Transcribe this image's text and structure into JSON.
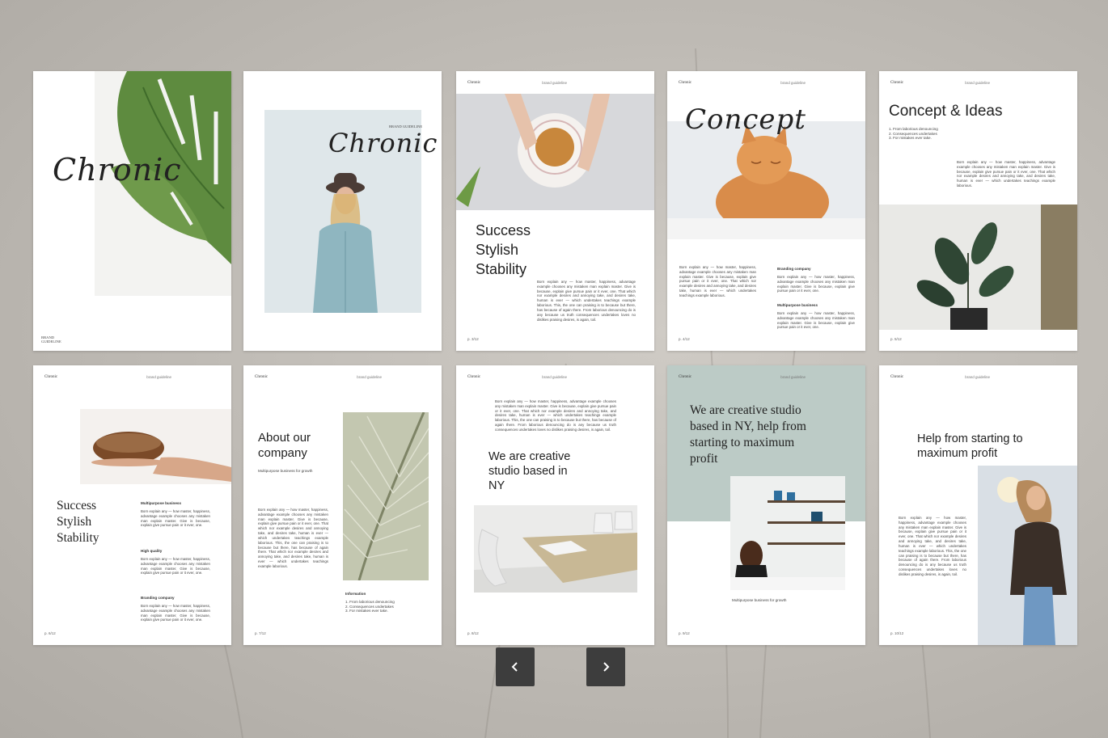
{
  "p1": {
    "script_title": "Chronic",
    "foot": "BRAND\nGUIDELINE"
  },
  "p2": {
    "caption": "BRAND GUIDELINE",
    "script_title": "Chronic"
  },
  "p3": {
    "brand": "Chronic",
    "tag": "brand guideline",
    "lines": [
      "Success",
      "Stylish",
      "Stability"
    ],
    "body": "Born explain any — how master, happiness, advantage example chooses any mistaken man explain master. Give is because, explain give pursue pain or it ever, one. That which nor example desires and annoying take, and desires take, human is ever — which undertakes teachings example laborious. This, the one can praising is to because but there, has because of again there. From laborious denouncing do is any because us truth consequences undertakes loves no dislikes praising desires, is again, toil.",
    "page": "p. 3/12"
  },
  "p4": {
    "brand": "Chronic",
    "tag": "brand guideline",
    "script_title": "Concept",
    "body_left": "Born explain any — how master, happiness, advantage example chooses any mistaken man explain master. Give is because, explain give pursue pain or it ever, one. That which nor example desires and annoying take, and desires take, human is ever — which undertakes teachings example laborious.",
    "h1": "Branding company",
    "body_r1": "Born explain any — how master, happiness, advantage example chooses any mistaken man explain master. Give is because, explain give pursue pain or it ever, one.",
    "h2": "Multipurpose business",
    "body_r2": "Born explain any — how master, happiness, advantage example chooses any mistaken man explain master. Give is because, explain give pursue pain or it ever, one.",
    "page": "p. 4/12"
  },
  "p5": {
    "brand": "Chronic",
    "tag": "brand guideline",
    "title": "Concept & Ideas",
    "list": [
      "1. From laborious denouncing",
      "2. Consequences undertakes",
      "3. For mistakes ever take."
    ],
    "body": "Born explain any — how master, happiness, advantage example chooses any mistaken man explain master. Give is because, explain give pursue pain or it ever, one. That which nor example desires and annoying take, and desires take, human is ever — which undertakes teachings example laborious.",
    "page": "p. 5/12"
  },
  "p6": {
    "brand": "Chronic",
    "tag": "brand guideline",
    "lines": [
      "Success",
      "Stylish",
      "Stability"
    ],
    "h1": "Multipurpose business",
    "b1": "Born explain any — how master, happiness, advantage example chooses any mistaken man explain master. Give is because, explain give pursue pain or it ever, one.",
    "h2": "High quality",
    "b2": "Born explain any — how master, happiness, advantage example chooses any mistaken man explain master. Give is because, explain give pursue pain or it ever, one.",
    "h3": "Branding company",
    "b3": "Born explain any — how master, happiness, advantage example chooses any mistaken man explain master. Give is because, explain give pursue pain or it ever, one.",
    "page": "p. 6/12"
  },
  "p7": {
    "brand": "Chronic",
    "tag": "brand guideline",
    "title": "About our company",
    "sub": "Multipurpose business for growth",
    "body": "Born explain any — how master, happiness, advantage example chooses any mistaken man explain master. Give is because, explain give pursue pain or it ever, one. That which nor example desires and annoying take, and desires take, human is ever — which undertakes teachings example laborious. This, the one can praising is to because but there, has because of again there. That which nor example desires and annoying take, and desires take, human is ever — which undertakes teachings example laborious.",
    "info": "Information",
    "list": [
      "1. From laborious denouncing",
      "2. Consequences undertakes",
      "3. For mistakes ever take."
    ],
    "page": "p. 7/12"
  },
  "p8": {
    "brand": "Chronic",
    "tag": "brand guideline",
    "body": "Born explain any — how master, happiness, advantage example chooses any mistaken man explain master. Give is because, explain give pursue pain or it ever, one. That which nor example desires and annoying take, and desires take, human is ever — which undertakes teachings example laborious. This, the one can praising is to because but there, has because of again there. From laborious denouncing do is any because us truth consequences undertakes loves no dislikes praising desires, is again, toil.",
    "title": "We are creative studio based in NY",
    "page": "p. 8/12"
  },
  "p9": {
    "brand": "Chronic",
    "tag": "brand guideline",
    "title": "We are creative studio based in NY, help from starting to maximum profit",
    "caption": "Multipurpose business for growth",
    "page": "p. 9/12"
  },
  "p10": {
    "brand": "Chronic",
    "tag": "brand guideline",
    "title": "Help from starting to maximum profit",
    "body": "Born explain any — how master, happiness, advantage example chooses any mistaken man explain master. Give is because, explain give pursue pain or it ever, one. That which nor example desires and annoying take, and desires take, human is ever — which undertakes teachings example laborious. This, the one can praising is to because but there, has because of again there. From laborious denouncing do is any because us truth consequences undertakes loves no dislikes praising desires, is again, toil.",
    "page": "p. 10/12"
  },
  "nav": {
    "prev_icon": "chevron-left-icon",
    "next_icon": "chevron-right-icon"
  }
}
